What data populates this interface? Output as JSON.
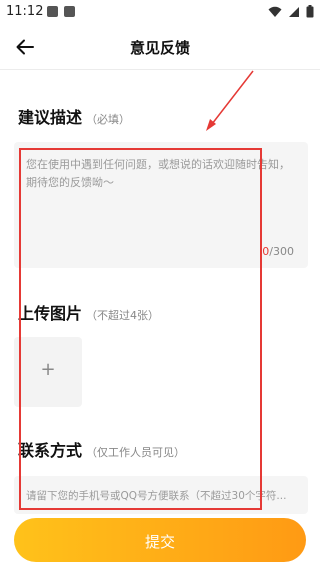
{
  "status_bar": {
    "time": "11:12"
  },
  "header": {
    "title": "意见反馈"
  },
  "description": {
    "title": "建议描述",
    "hint": "（必填）",
    "placeholder": "您在使用中遇到任何问题，或想说的话欢迎随时告知，期待您的反馈呦～",
    "counter_current": "0",
    "counter_total": "/300"
  },
  "upload": {
    "title": "上传图片",
    "hint": "（不超过4张）",
    "plus": "+"
  },
  "contact": {
    "title": "联系方式",
    "hint": "（仅工作人员可见）",
    "placeholder": "请留下您的手机号或QQ号方便联系（不超过30个字符..."
  },
  "submit": {
    "label": "提交"
  },
  "colors": {
    "accent_start": "#ffc21a",
    "accent_end": "#ff9a14",
    "annotation_red": "#e53935"
  }
}
